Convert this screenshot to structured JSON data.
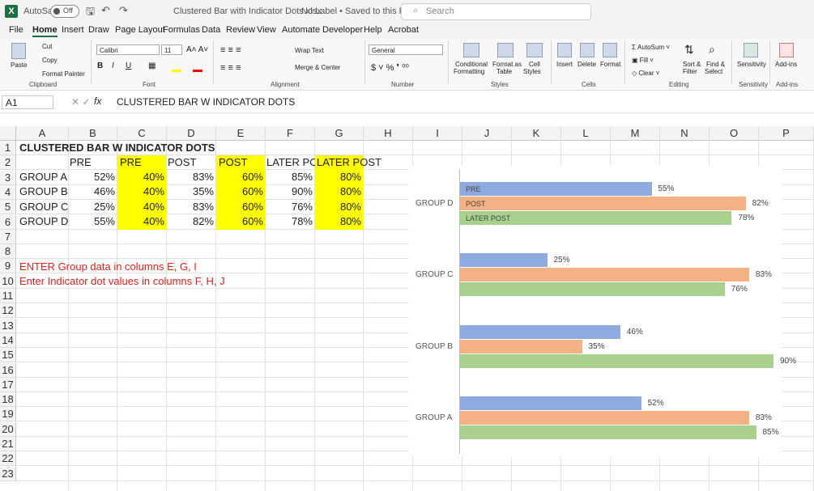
{
  "titlebar": {
    "app_icon": "X",
    "autosave_label": "AutoSave",
    "autosave_state": "Off",
    "filename": "Clustered Bar with Indicator Dots.xlsx",
    "label_status": "No Label • Saved to this PC",
    "search_placeholder": "Search"
  },
  "menu": [
    "File",
    "Home",
    "Insert",
    "Draw",
    "Page Layout",
    "Formulas",
    "Data",
    "Review",
    "View",
    "Automate",
    "Developer",
    "Help",
    "Acrobat"
  ],
  "ribbon": {
    "clipboard": {
      "paste": "Paste",
      "cut": "Cut",
      "copy": "Copy",
      "format_painter": "Format Painter",
      "group": "Clipboard"
    },
    "font": {
      "name": "Calibri",
      "size": "11",
      "group": "Font"
    },
    "alignment": {
      "wrap": "Wrap Text",
      "merge": "Merge & Center",
      "group": "Alignment"
    },
    "number": {
      "format": "General",
      "group": "Number"
    },
    "styles": {
      "cond1": "Conditional",
      "cond2": "Formatting",
      "fmt1": "Format as",
      "fmt2": "Table",
      "cell1": "Cell",
      "cell2": "Styles",
      "group": "Styles"
    },
    "cells": {
      "insert": "Insert",
      "delete": "Delete",
      "format": "Format",
      "group": "Cells"
    },
    "editing": {
      "autosum": "AutoSum",
      "fill": "Fill",
      "clear": "Clear",
      "sort1": "Sort &",
      "sort2": "Filter",
      "find1": "Find &",
      "find2": "Select",
      "group": "Editing"
    },
    "sensitivity": {
      "label": "Sensitivity",
      "group": "Sensitivity"
    },
    "addins": {
      "label": "Add-ins",
      "group": "Add-ins"
    }
  },
  "formula_bar": {
    "name_box": "A1",
    "fx": "fx",
    "content": "CLUSTERED BAR W INDICATOR DOTS"
  },
  "columns": [
    "A",
    "B",
    "C",
    "D",
    "E",
    "F",
    "G",
    "H",
    "I",
    "J",
    "K",
    "L",
    "M",
    "N",
    "O",
    "P"
  ],
  "rows": [
    "1",
    "2",
    "3",
    "4",
    "5",
    "6",
    "7",
    "8",
    "9",
    "10",
    "11",
    "12",
    "13",
    "14",
    "15",
    "16",
    "17",
    "18",
    "19",
    "20",
    "21",
    "22",
    "23"
  ],
  "sheet": {
    "title": "CLUSTERED BAR W INDICATOR DOTS",
    "headers": [
      "PRE",
      "PRE",
      "POST",
      "POST",
      "LATER POS",
      "LATER POST"
    ],
    "data": [
      [
        "GROUP A",
        "52%",
        "40%",
        "83%",
        "60%",
        "85%",
        "80%"
      ],
      [
        "GROUP B",
        "46%",
        "40%",
        "35%",
        "60%",
        "90%",
        "80%"
      ],
      [
        "GROUP C",
        "25%",
        "40%",
        "83%",
        "60%",
        "76%",
        "80%"
      ],
      [
        "GROUP D",
        "55%",
        "40%",
        "82%",
        "60%",
        "78%",
        "80%"
      ]
    ],
    "note1": "ENTER Group data in columns E, G, I",
    "note2": "Enter Indicator dot values in columns F, H, J"
  },
  "chart_data": {
    "type": "bar",
    "orientation": "horizontal",
    "categories": [
      "GROUP D",
      "GROUP C",
      "GROUP B",
      "GROUP A"
    ],
    "series": [
      {
        "name": "PRE",
        "values": [
          55,
          25,
          46,
          52
        ],
        "color": "#8faadc"
      },
      {
        "name": "POST",
        "values": [
          82,
          83,
          35,
          83
        ],
        "color": "#f4b183"
      },
      {
        "name": "LATER POST",
        "values": [
          78,
          76,
          90,
          85
        ],
        "color": "#a9d18e"
      }
    ],
    "value_labels": {
      "PRE": [
        "55%",
        "25%",
        "46%",
        "52%"
      ],
      "POST": [
        "82%",
        "83%",
        "35%",
        "83%"
      ],
      "LATER POST": [
        "78%",
        "76%",
        "90%",
        "85%"
      ]
    },
    "xlim": [
      0,
      100
    ],
    "legend": "inside bars of GROUP D"
  }
}
